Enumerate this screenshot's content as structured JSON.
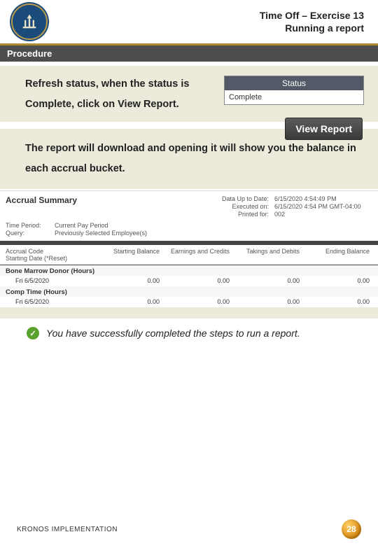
{
  "header": {
    "title_line1": "Time Off – Exercise 13",
    "title_line2": "Running a report"
  },
  "procedure_label": "Procedure",
  "step_text": "Refresh status, when the status is Complete, click on View Report.",
  "status": {
    "header": "Status",
    "value": "Complete"
  },
  "view_report_label": "View Report",
  "note_text": "The report will download and opening it will show you the balance in each accrual bucket.",
  "report": {
    "title": "Accrual Summary",
    "meta": {
      "data_up_to_label": "Data Up to Date:",
      "data_up_to_value": "6/15/2020 4:54:49 PM",
      "executed_on_label": "Executed on:",
      "executed_on_value": "6/15/2020 4:54 PM GMT-04:00",
      "printed_for_label": "Printed for:",
      "printed_for_value": "002"
    },
    "params": {
      "time_period_label": "Time Period:",
      "time_period_value": "Current Pay Period",
      "query_label": "Query:",
      "query_value": "Previously Selected Employee(s)"
    },
    "columns": {
      "c1a": "Accrual Code",
      "c1b": "Starting Date (*Reset)",
      "c2": "Starting Balance",
      "c3": "Earnings and Credits",
      "c4": "Takings and Debits",
      "c5": "Ending Balance"
    },
    "rows": [
      {
        "group": "Bone Marrow Donor (Hours)",
        "date": "Fri 6/5/2020",
        "start": "0.00",
        "earn": "0.00",
        "take": "0.00",
        "end": "0.00"
      },
      {
        "group": "Comp Time (Hours)",
        "date": "Fri 6/5/2020",
        "start": "0.00",
        "earn": "0.00",
        "take": "0.00",
        "end": "0.00"
      }
    ]
  },
  "success_text": "You have successfully completed the steps to run a report.",
  "footer_text": "KRONOS IMPLEMENTATION",
  "page_number": "28"
}
